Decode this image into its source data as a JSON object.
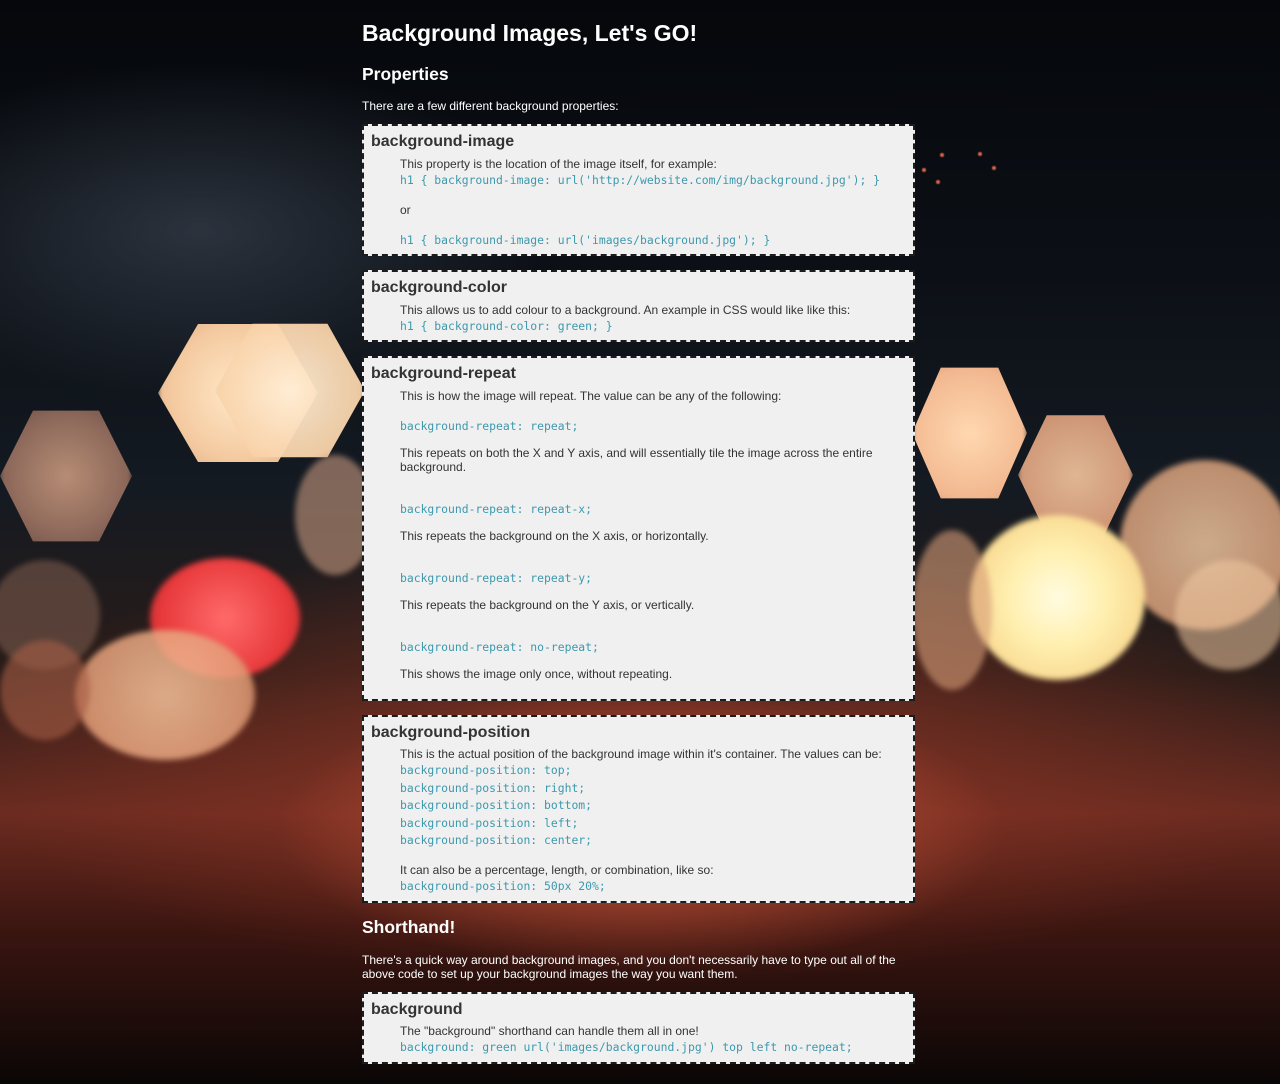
{
  "page": {
    "title": "Background Images, Let's GO!",
    "properties_heading": "Properties",
    "properties_intro": "There are a few different background properties:",
    "shorthand_heading": "Shorthand!",
    "shorthand_intro": "There's a quick way around background images, and you don't necessarily have to type out all of the above code to set up your background images the way you want them."
  },
  "boxes": {
    "image": {
      "heading": "background-image",
      "desc": "This property is the location of the image itself, for example:",
      "code1": "h1 { background-image: url('http://website.com/img/background.jpg'); }",
      "or": "or",
      "code2": "h1 { background-image: url('images/background.jpg'); }"
    },
    "color": {
      "heading": "background-color",
      "desc": "This allows us to add colour to a background. An example in CSS would like like this:",
      "code": "h1 { background-color: green; }"
    },
    "repeat": {
      "heading": "background-repeat",
      "desc": "This is how the image will repeat. The value can be any of the following:",
      "items": [
        {
          "code": "background-repeat: repeat;",
          "text": "This repeats on both the X and Y axis, and will essentially tile the image across the entire background."
        },
        {
          "code": "background-repeat: repeat-x;",
          "text": "This repeats the background on the X axis, or horizontally."
        },
        {
          "code": "background-repeat: repeat-y;",
          "text": "This repeats the background on the Y axis, or vertically."
        },
        {
          "code": "background-repeat: no-repeat;",
          "text": "This shows the image only once, without repeating."
        }
      ]
    },
    "position": {
      "heading": "background-position",
      "desc": "This is the actual position of the background image within it's container. The values can be:",
      "values": [
        "background-position: top;",
        "background-position: right;",
        "background-position: bottom;",
        "background-position: left;",
        "background-position: center;"
      ],
      "extra": "It can also be a percentage, length, or combination, like so:",
      "extra_code": "background-position: 50px 20%;"
    },
    "shorthand": {
      "heading": "background",
      "desc": "The \"background\" shorthand can handle them all in one!",
      "code": "background: green url('images/background.jpg') top left no-repeat;"
    }
  },
  "colors": {
    "box_bg": "#f0f0f0",
    "box_border": "#1c1c1c",
    "code_text": "#3d99ad",
    "body_text": "#333333",
    "page_text": "#ffffff"
  }
}
